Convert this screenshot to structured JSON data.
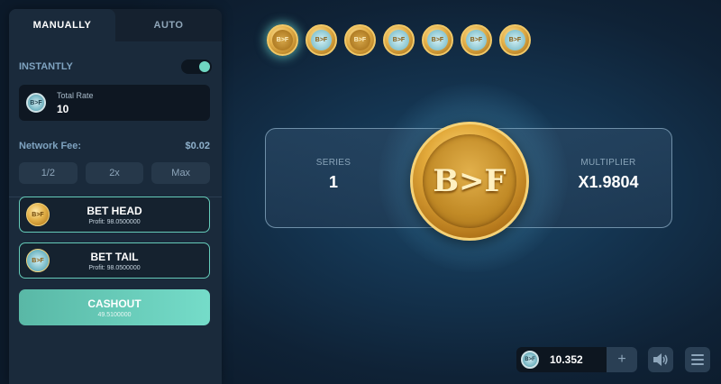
{
  "tabs": [
    {
      "label": "MANUALLY",
      "active": true
    },
    {
      "label": "AUTO",
      "active": false
    }
  ],
  "instantly": {
    "label": "INSTANTLY",
    "enabled": true
  },
  "total_rate": {
    "label": "Total Rate",
    "value": "10",
    "chip_text": "B>F"
  },
  "network_fee": {
    "label": "Network Fee:",
    "value": "$0.02"
  },
  "quick_buttons": [
    "1/2",
    "2x",
    "Max"
  ],
  "bet_head": {
    "title": "BET HEAD",
    "profit": "Profit: 98.0500000",
    "coin_text": "B>F"
  },
  "bet_tail": {
    "title": "BET TAIL",
    "profit": "Profit: 98.0500000",
    "coin_text": "B>F"
  },
  "cashout": {
    "title": "CASHOUT",
    "amount": "49.5100000"
  },
  "history": [
    {
      "side": "head",
      "text": "B>F"
    },
    {
      "side": "tail",
      "text": "B>F"
    },
    {
      "side": "head",
      "text": "B>F"
    },
    {
      "side": "tail",
      "text": "B>F"
    },
    {
      "side": "tail",
      "text": "B>F"
    },
    {
      "side": "tail",
      "text": "B>F"
    },
    {
      "side": "tail",
      "text": "B>F"
    }
  ],
  "series": {
    "label": "SERIES",
    "value": "1"
  },
  "multiplier": {
    "label": "MULTIPLIER",
    "value": "X1.9804"
  },
  "main_coin": {
    "text": "B>F"
  },
  "balance": {
    "value": "10.352",
    "chip_text": "B>F",
    "plus": "+"
  },
  "colors": {
    "accent": "#6fd6c2",
    "gold": "#e2a93a",
    "panel": "#1a2a3b"
  }
}
